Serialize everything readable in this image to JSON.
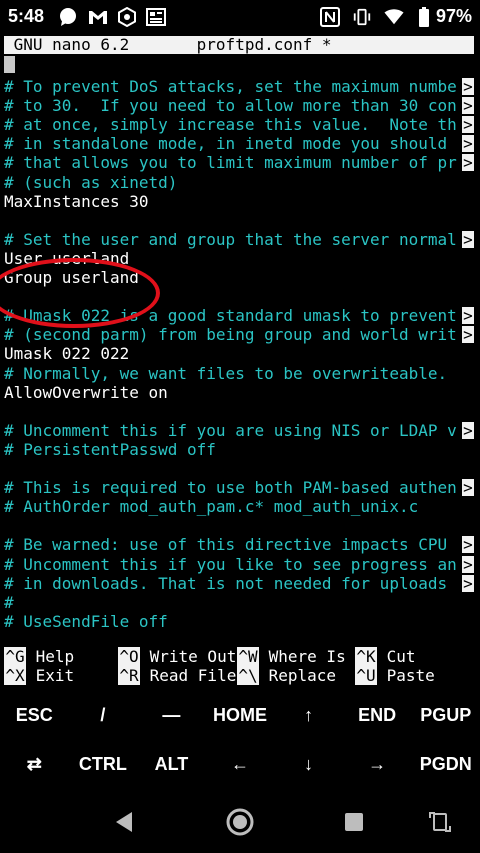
{
  "status_bar": {
    "time": "5:48",
    "battery_percent": "97%",
    "icons": [
      "chat-bubble-icon",
      "gmail-icon",
      "hexagon-app-icon",
      "news-icon",
      "nfc-icon",
      "vibrate-icon",
      "wifi-icon",
      "battery-icon"
    ]
  },
  "nano": {
    "title": " GNU nano 6.2       proftpd.conf *",
    "lines": [
      {
        "text": "# To prevent DoS attacks, set the maximum numbe",
        "type": "comment",
        "overflow": true
      },
      {
        "text": "# to 30.  If you need to allow more than 30 con",
        "type": "comment",
        "overflow": true
      },
      {
        "text": "# at once, simply increase this value.  Note th",
        "type": "comment",
        "overflow": true
      },
      {
        "text": "# in standalone mode, in inetd mode you should ",
        "type": "comment",
        "overflow": true
      },
      {
        "text": "# that allows you to limit maximum number of pr",
        "type": "comment",
        "overflow": true
      },
      {
        "text": "# (such as xinetd)",
        "type": "comment",
        "overflow": false
      },
      {
        "text": "MaxInstances 30",
        "type": "plain",
        "overflow": false
      },
      {
        "text": "",
        "type": "plain",
        "overflow": false
      },
      {
        "text": "# Set the user and group that the server normal",
        "type": "comment",
        "overflow": true
      },
      {
        "text": "User userland",
        "type": "plain",
        "overflow": false
      },
      {
        "text": "Group userland",
        "type": "plain",
        "overflow": false
      },
      {
        "text": "",
        "type": "plain",
        "overflow": false
      },
      {
        "text": "# Umask 022 is a good standard umask to prevent",
        "type": "comment",
        "overflow": true
      },
      {
        "text": "# (second parm) from being group and world writ",
        "type": "comment",
        "overflow": true
      },
      {
        "text": "Umask 022 022",
        "type": "plain",
        "overflow": false
      },
      {
        "text": "# Normally, we want files to be overwriteable.",
        "type": "comment",
        "overflow": false
      },
      {
        "text": "AllowOverwrite on",
        "type": "plain",
        "overflow": false
      },
      {
        "text": "",
        "type": "plain",
        "overflow": false
      },
      {
        "text": "# Uncomment this if you are using NIS or LDAP v",
        "type": "comment",
        "overflow": true
      },
      {
        "text": "# PersistentPasswd off",
        "type": "comment",
        "overflow": false
      },
      {
        "text": "",
        "type": "plain",
        "overflow": false
      },
      {
        "text": "# This is required to use both PAM-based authen",
        "type": "comment",
        "overflow": true
      },
      {
        "text": "# AuthOrder mod_auth_pam.c* mod_auth_unix.c",
        "type": "comment",
        "overflow": false
      },
      {
        "text": "",
        "type": "plain",
        "overflow": false
      },
      {
        "text": "# Be warned: use of this directive impacts CPU ",
        "type": "comment",
        "overflow": true
      },
      {
        "text": "# Uncomment this if you like to see progress an",
        "type": "comment",
        "overflow": true
      },
      {
        "text": "# in downloads. That is not needed for uploads ",
        "type": "comment",
        "overflow": true
      },
      {
        "text": "#",
        "type": "comment",
        "overflow": false
      },
      {
        "text": "# UseSendFile off",
        "type": "comment",
        "overflow": false
      }
    ],
    "overflow_marker": ">",
    "shortcuts_row1": [
      {
        "key": "^G",
        "label": " Help"
      },
      {
        "key": "^O",
        "label": " Write Out"
      },
      {
        "key": "^W",
        "label": " Where Is"
      },
      {
        "key": "^K",
        "label": " Cut"
      }
    ],
    "shortcuts_row2": [
      {
        "key": "^X",
        "label": " Exit"
      },
      {
        "key": "^R",
        "label": " Read File"
      },
      {
        "key": "^\\",
        "label": " Replace"
      },
      {
        "key": "^U",
        "label": " Paste"
      }
    ]
  },
  "extra_keys": {
    "row1": [
      "ESC",
      "/",
      "—",
      "HOME",
      "↑",
      "END",
      "PGUP"
    ],
    "row2": [
      "⇄",
      "CTRL",
      "ALT",
      "←",
      "↓",
      "→",
      "PGDN"
    ]
  },
  "colors": {
    "comment": "#2bc4c4",
    "title_bg": "#f2f2f2",
    "annotation": "#e0101a"
  }
}
